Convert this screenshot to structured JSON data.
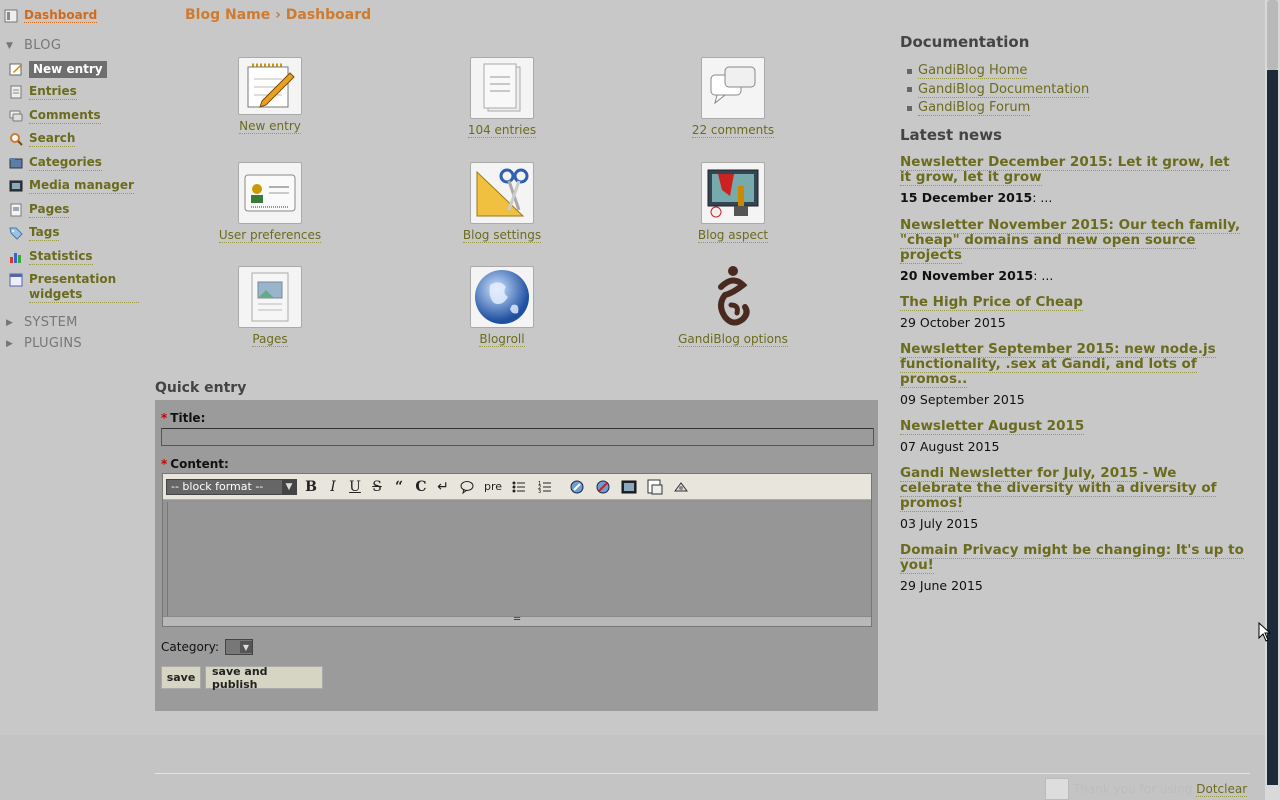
{
  "sidebar": {
    "dashboard": "Dashboard",
    "sections": {
      "blog": "BLOG",
      "system": "SYSTEM",
      "plugins": "PLUGINS"
    },
    "items": [
      {
        "label": "New entry",
        "icon": "new-entry-icon",
        "active": true
      },
      {
        "label": "Entries",
        "icon": "entries-icon"
      },
      {
        "label": "Comments",
        "icon": "comments-icon"
      },
      {
        "label": "Search",
        "icon": "search-icon"
      },
      {
        "label": "Categories",
        "icon": "categories-icon"
      },
      {
        "label": "Media manager",
        "icon": "media-icon"
      },
      {
        "label": "Pages",
        "icon": "pages-icon"
      },
      {
        "label": "Tags",
        "icon": "tags-icon"
      },
      {
        "label": "Statistics",
        "icon": "statistics-icon"
      },
      {
        "label": "Presentation widgets",
        "icon": "widgets-icon"
      }
    ]
  },
  "header": {
    "blog_name": "Blog Name",
    "separator": "›",
    "page": "Dashboard"
  },
  "dashboard_icons": [
    {
      "label": "New entry",
      "icon": "notepad-pencil-icon"
    },
    {
      "label": "104 entries",
      "icon": "document-stack-icon"
    },
    {
      "label": "22 comments",
      "icon": "speech-bubbles-icon"
    },
    {
      "label": "User preferences",
      "icon": "id-card-icon"
    },
    {
      "label": "Blog settings",
      "icon": "ruler-scissors-icon"
    },
    {
      "label": "Blog aspect",
      "icon": "paint-monitor-icon"
    },
    {
      "label": "Pages",
      "icon": "page-image-icon"
    },
    {
      "label": "Blogroll",
      "icon": "globe-icon"
    },
    {
      "label": "GandiBlog options",
      "icon": "gandi-logo-icon"
    }
  ],
  "quick_entry": {
    "heading": "Quick entry",
    "title_label": "Title:",
    "title_value": "",
    "content_label": "Content:",
    "required_mark": "*",
    "block_format": "-- block format --",
    "toolbar": {
      "bold": "B",
      "italic": "I",
      "underline": "U",
      "strike": "S",
      "quote": "“",
      "code": "C",
      "br": "↵",
      "comment": "💬",
      "pre": "pre"
    },
    "category_label": "Category:",
    "save": "save",
    "save_publish": "save and publish"
  },
  "documentation": {
    "heading": "Documentation",
    "links": [
      "GandiBlog Home",
      "GandiBlog Documentation",
      "GandiBlog Forum"
    ]
  },
  "news": {
    "heading": "Latest news",
    "items": [
      {
        "title": "Newsletter December 2015: Let it grow, let it grow, let it grow",
        "date": "15 December 2015",
        "suffix": ": ..."
      },
      {
        "title": "Newsletter November 2015: Our tech family, \"cheap\" domains and new open source projects",
        "date": "20 November 2015",
        "suffix": ": ..."
      },
      {
        "title": "The High Price of Cheap",
        "date": "29 October 2015",
        "suffix": ""
      },
      {
        "title": "Newsletter September 2015: new node.js functionality, .sex at Gandi, and lots of promos..",
        "date": "09 September 2015",
        "suffix": ""
      },
      {
        "title": "Newsletter August 2015",
        "date": "07 August 2015",
        "suffix": ""
      },
      {
        "title": "Gandi Newsletter for July, 2015 - We celebrate the diversity with a diversity of promos!",
        "date": "03 July 2015",
        "suffix": ""
      },
      {
        "title": "Domain Privacy might be changing: It's up to you!",
        "date": "29 June 2015",
        "suffix": ""
      }
    ]
  },
  "footer": {
    "thanks": "Thank you for using",
    "brand": "Dotclear"
  }
}
